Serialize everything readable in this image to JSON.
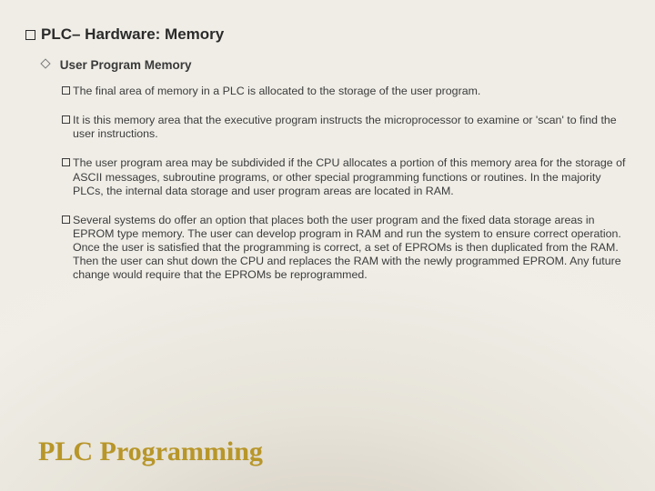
{
  "heading": {
    "prefix": "PLC",
    "rest": " – Hardware: Memory"
  },
  "subheading": "User Program Memory",
  "bullets": [
    "The final area of memory in a PLC is allocated to the storage of the user program.",
    "It is this memory area that the executive program instructs the microprocessor to examine or 'scan' to find the user instructions.",
    "The user program area may be subdivided if the CPU allocates a portion of this memory area for the storage of ASCII messages, subroutine programs, or other special programming functions or routines. In the majority PLCs, the internal data storage and user program areas are located in RAM.",
    "Several systems do offer an option that places both the user program and the fixed data storage areas in EPROM type memory. The user can develop program in RAM and run the system to ensure correct operation. Once the user is satisfied that the programming is correct, a set of EPROMs is then duplicated from the RAM. Then the user can shut down the CPU and replaces the RAM with the newly programmed EPROM. Any future change would require that the EPROMs be reprogrammed."
  ],
  "footer": "PLC Programming"
}
